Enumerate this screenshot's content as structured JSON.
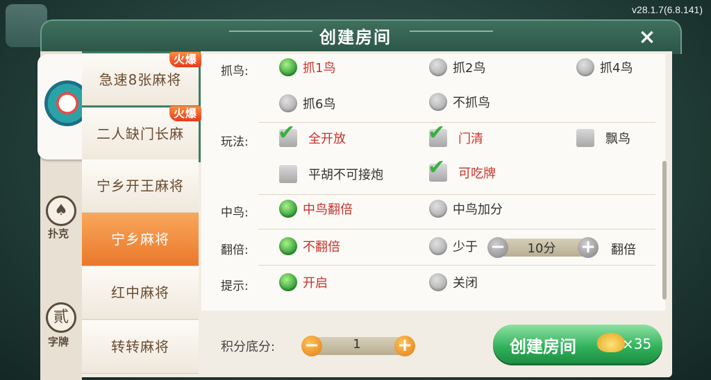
{
  "version": "v28.1.7(6.8.141)",
  "title": "创建房间",
  "close_label": "×",
  "categories": {
    "poker_label": "扑克",
    "poker_icon": "spade-icon",
    "zipai_label": "字牌",
    "zipai_icon_char": "貳"
  },
  "games": [
    {
      "label": "急速8张麻将",
      "badge": "火爆"
    },
    {
      "label": "二人缺门长麻",
      "badge": "火爆"
    },
    {
      "label": "宁乡开王麻将",
      "badge": ""
    },
    {
      "label": "宁乡麻将",
      "badge": "",
      "active": true
    },
    {
      "label": "红中麻将",
      "badge": ""
    },
    {
      "label": "转转麻将",
      "badge": ""
    }
  ],
  "rules": {
    "zhuaniao": {
      "label": "抓鸟:",
      "options": [
        {
          "text": "抓1鸟",
          "selected": true
        },
        {
          "text": "抓2鸟",
          "selected": false
        },
        {
          "text": "抓4鸟",
          "selected": false
        },
        {
          "text": "抓6鸟",
          "selected": false
        },
        {
          "text": "不抓鸟",
          "selected": false
        }
      ]
    },
    "wanfa": {
      "label": "玩法:",
      "options": [
        {
          "text": "全开放",
          "checked": true
        },
        {
          "text": "门清",
          "checked": true
        },
        {
          "text": "飘鸟",
          "checked": false
        },
        {
          "text": "平胡不可接炮",
          "checked": false
        },
        {
          "text": "可吃牌",
          "checked": true
        }
      ]
    },
    "zhongniao": {
      "label": "中鸟:",
      "options": [
        {
          "text": "中鸟翻倍",
          "selected": true
        },
        {
          "text": "中鸟加分",
          "selected": false
        }
      ]
    },
    "fanbei": {
      "label": "翻倍:",
      "options": [
        {
          "text": "不翻倍",
          "selected": true
        },
        {
          "text": "少于",
          "selected": false
        }
      ],
      "stepper_value": "10分",
      "suffix": "翻倍"
    },
    "tishi": {
      "label": "提示:",
      "options": [
        {
          "text": "开启",
          "selected": true
        },
        {
          "text": "关闭",
          "selected": false
        }
      ]
    }
  },
  "base_score": {
    "label": "积分底分:",
    "value": "1",
    "minus": "−",
    "plus": "+"
  },
  "create_button": {
    "label": "创建房间",
    "cost": "×35",
    "icon": "gold-ingot-icon"
  }
}
